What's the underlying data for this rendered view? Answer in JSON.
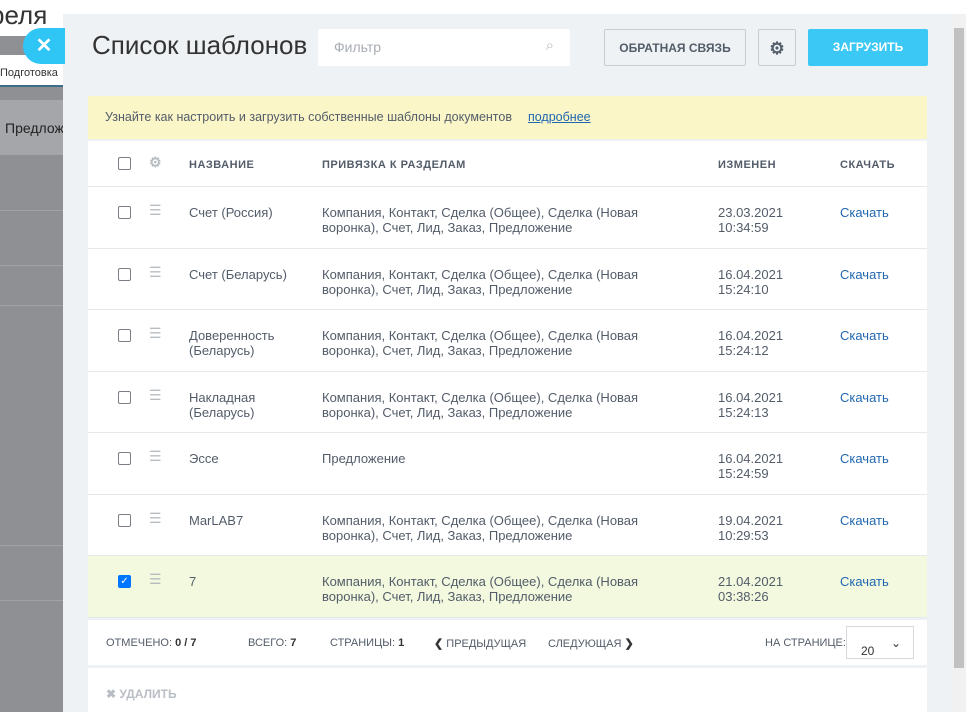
{
  "background": {
    "title_fragment": "реля",
    "tab": "Подготовка",
    "item": "Предложение"
  },
  "header": {
    "title": "Список шаблонов",
    "filter_placeholder": "Фильтр",
    "feedback": "ОБРАТНАЯ СВЯЗЬ",
    "upload": "ЗАГРУЗИТЬ"
  },
  "notice": {
    "text": "Узнайте как настроить и загрузить собственные шаблоны документов",
    "link": "подробнее"
  },
  "columns": {
    "name": "НАЗВАНИЕ",
    "binding": "ПРИВЯЗКА К РАЗДЕЛАМ",
    "modified": "ИЗМЕНЕН",
    "download": "СКАЧАТЬ"
  },
  "rows": [
    {
      "name": "Счет (Россия)",
      "binding": "Компания, Контакт, Сделка (Общее), Сделка (Новая воронка), Счет, Лид, Заказ, Предложение",
      "date": "23.03.2021",
      "time": "10:34:59",
      "download": "Скачать",
      "checked": false
    },
    {
      "name": "Счет (Беларусь)",
      "binding": "Компания, Контакт, Сделка (Общее), Сделка (Новая воронка), Счет, Лид, Заказ, Предложение",
      "date": "16.04.2021",
      "time": "15:24:10",
      "download": "Скачать",
      "checked": false
    },
    {
      "name": "Доверенность (Беларусь)",
      "binding": "Компания, Контакт, Сделка (Общее), Сделка (Новая воронка), Счет, Лид, Заказ, Предложение",
      "date": "16.04.2021",
      "time": "15:24:12",
      "download": "Скачать",
      "checked": false
    },
    {
      "name": "Накладная (Беларусь)",
      "binding": "Компания, Контакт, Сделка (Общее), Сделка (Новая воронка), Счет, Лид, Заказ, Предложение",
      "date": "16.04.2021",
      "time": "15:24:13",
      "download": "Скачать",
      "checked": false
    },
    {
      "name": "Эссе",
      "binding": "Предложение",
      "date": "16.04.2021",
      "time": "15:24:59",
      "download": "Скачать",
      "checked": false
    },
    {
      "name": "MarLAB7",
      "binding": "Компания, Контакт, Сделка (Общее), Сделка (Новая воронка), Счет, Лид, Заказ, Предложение",
      "date": "19.04.2021",
      "time": "10:29:53",
      "download": "Скачать",
      "checked": false
    },
    {
      "name": "7",
      "binding": "Компания, Контакт, Сделка (Общее), Сделка (Новая воронка), Счет, Лид, Заказ, Предложение",
      "date": "21.04.2021",
      "time": "03:38:26",
      "download": "Скачать",
      "checked": true
    }
  ],
  "footer": {
    "selected_label": "ОТМЕЧЕНО:",
    "selected": "0 / 7",
    "total_label": "ВСЕГО:",
    "total": "7",
    "pages_label": "СТРАНИЦЫ:",
    "pages": "1",
    "prev": "ПРЕДЫДУЩАЯ",
    "next": "СЛЕДУЮЩАЯ",
    "per_page_label": "НА СТРАНИЦЕ:",
    "per_page": "20"
  },
  "actions": {
    "delete": "УДАЛИТЬ"
  }
}
